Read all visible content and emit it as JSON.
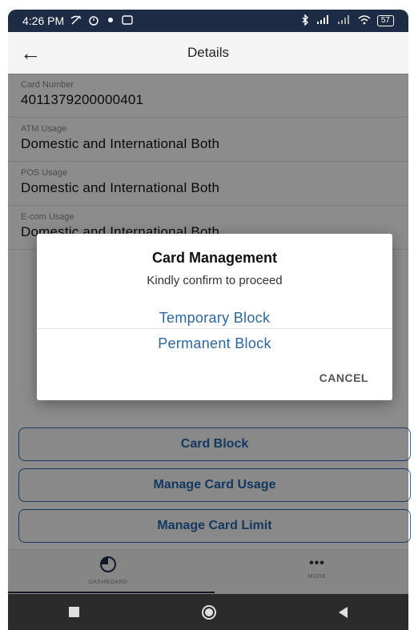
{
  "status_bar": {
    "time": "4:26 PM",
    "left_icons": [
      "wifi-off-icon",
      "alarm-icon",
      "location-icon",
      "notification-icon"
    ],
    "right_icons": [
      "bluetooth-icon",
      "signal-icon",
      "signal-icon",
      "wifi-icon"
    ],
    "battery": "57"
  },
  "app_bar": {
    "back_icon": "arrow-left-icon",
    "title": "Details"
  },
  "fields": [
    {
      "label": "Card Number",
      "value": "4011379200000401"
    },
    {
      "label": "ATM Usage",
      "value": "Domestic and International Both"
    },
    {
      "label": "POS Usage",
      "value": "Domestic and International Both"
    },
    {
      "label": "E-com Usage",
      "value": "Domestic and International Both"
    }
  ],
  "actions": {
    "card_block": "Card Block",
    "manage_usage": "Manage Card Usage",
    "manage_limit": "Manage Card Limit"
  },
  "bottom_nav": {
    "dashboard_label": "DASHBOARD",
    "more_label": "MORE",
    "more_glyph": "•••"
  },
  "dialog": {
    "title": "Card Management",
    "subtitle": "Kindly confirm to proceed",
    "option_temporary": "Temporary Block",
    "option_permanent": "Permanent Block",
    "cancel": "CANCEL"
  },
  "colors": {
    "accent": "#2468b2",
    "status_bar": "#1d2b45",
    "system_nav": "#2b2b2b"
  }
}
